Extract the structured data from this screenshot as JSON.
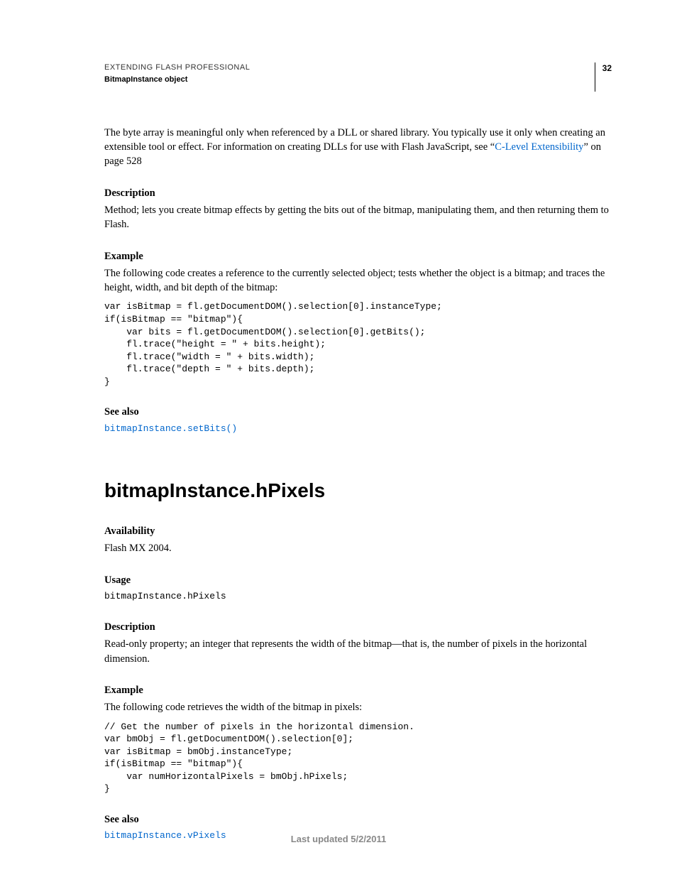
{
  "header": {
    "title": "EXTENDING FLASH PROFESSIONAL",
    "subtitle": "BitmapInstance object",
    "page_number": "32"
  },
  "intro": {
    "p1a": "The byte array is meaningful only when referenced by a DLL or shared library. You typically use it only when creating an extensible tool or effect. For information on creating DLLs for use with Flash JavaScript, see “",
    "p1_link": "C-Level Extensibility",
    "p1b": "” on page 528"
  },
  "sec1": {
    "description_head": "Description",
    "description_body": "Method; lets you create bitmap effects by getting the bits out of the bitmap, manipulating them, and then returning them to Flash.",
    "example_head": "Example",
    "example_body": "The following code creates a reference to the currently selected object; tests whether the object is a bitmap; and traces the height, width, and bit depth of the bitmap:",
    "code": "var isBitmap = fl.getDocumentDOM().selection[0].instanceType;\nif(isBitmap == \"bitmap\"){\n    var bits = fl.getDocumentDOM().selection[0].getBits();\n    fl.trace(\"height = \" + bits.height);\n    fl.trace(\"width = \" + bits.width);\n    fl.trace(\"depth = \" + bits.depth);\n}",
    "seealso_head": "See also",
    "seealso_link": "bitmapInstance.setBits()"
  },
  "topic2": {
    "title": "bitmapInstance.hPixels",
    "availability_head": "Availability",
    "availability_body": "Flash MX 2004.",
    "usage_head": "Usage",
    "usage_code": "bitmapInstance.hPixels",
    "description_head": "Description",
    "description_body": "Read-only property; an integer that represents the width of the bitmap—that is, the number of pixels in the horizontal dimension.",
    "example_head": "Example",
    "example_body": "The following code retrieves the width of the bitmap in pixels:",
    "code": "// Get the number of pixels in the horizontal dimension.\nvar bmObj = fl.getDocumentDOM().selection[0];\nvar isBitmap = bmObj.instanceType;\nif(isBitmap == \"bitmap\"){\n    var numHorizontalPixels = bmObj.hPixels;\n}",
    "seealso_head": "See also",
    "seealso_link": "bitmapInstance.vPixels"
  },
  "footer": {
    "text": "Last updated 5/2/2011"
  }
}
